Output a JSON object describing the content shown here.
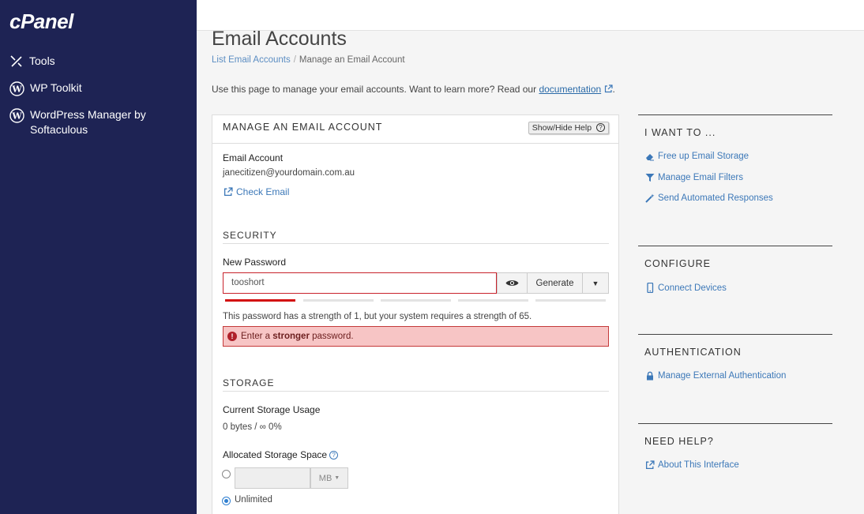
{
  "sidebar": {
    "logo": "cPanel",
    "items": [
      {
        "label": "Tools",
        "icon": "tools-icon"
      },
      {
        "label": "WP Toolkit",
        "icon": "wordpress-icon"
      },
      {
        "label": "WordPress Manager by Softaculous",
        "icon": "wordpress-icon"
      }
    ]
  },
  "page": {
    "title": "Email Accounts",
    "breadcrumb": {
      "parent": "List Email Accounts",
      "separator": "/",
      "current": "Manage an Email Account"
    },
    "intro_text": "Use this page to manage your email accounts. Want to learn more? Read our ",
    "intro_link": "documentation",
    "intro_end": "."
  },
  "panel": {
    "title": "MANAGE AN EMAIL ACCOUNT",
    "help_button": "Show/Hide Help",
    "email_label": "Email Account",
    "email_value": "janecitizen@yourdomain.com.au",
    "check_email": "Check Email",
    "security": {
      "title": "SECURITY",
      "password_label": "New Password",
      "password_value": "tooshort",
      "generate_label": "Generate",
      "strength_level": 1,
      "strength_segments": 5,
      "strength_message": "This password has a strength of 1, but your system requires a strength of 65.",
      "error_prefix": "Enter a ",
      "error_strong": "stronger",
      "error_suffix": " password."
    },
    "storage": {
      "title": "STORAGE",
      "usage_label": "Current Storage Usage",
      "usage_value": "0 bytes / ∞ 0%",
      "allocated_label": "Allocated Storage Space",
      "unit": "MB",
      "unlimited_label": "Unlimited",
      "selected": "unlimited"
    }
  },
  "right": {
    "i_want_to": {
      "title": "I WANT TO ...",
      "links": [
        "Free up Email Storage",
        "Manage Email Filters",
        "Send Automated Responses"
      ]
    },
    "configure": {
      "title": "CONFIGURE",
      "links": [
        "Connect Devices"
      ]
    },
    "authentication": {
      "title": "AUTHENTICATION",
      "links": [
        "Manage External Authentication"
      ]
    },
    "need_help": {
      "title": "NEED HELP?",
      "links": [
        "About This Interface"
      ]
    }
  },
  "colors": {
    "sidebar": "#1e2354",
    "link": "#3c78b8",
    "error": "#c8232c",
    "strength": "#d30f0f"
  }
}
